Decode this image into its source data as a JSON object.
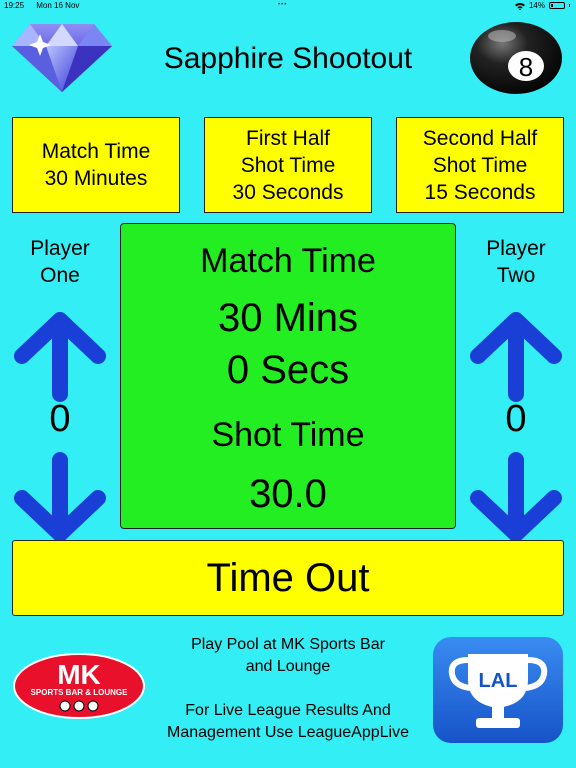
{
  "status_bar": {
    "time": "19:25",
    "date": "Mon 16 Nov",
    "battery": "14%"
  },
  "header": {
    "title": "Sapphire Shootout"
  },
  "settings": [
    {
      "lines": [
        "Match Time",
        "30 Minutes"
      ]
    },
    {
      "lines": [
        "First Half",
        "Shot Time",
        "30 Seconds"
      ]
    },
    {
      "lines": [
        "Second Half",
        "Shot Time",
        "15 Seconds"
      ]
    }
  ],
  "player_one": {
    "label_line1": "Player",
    "label_line2": "One",
    "score": "0"
  },
  "player_two": {
    "label_line1": "Player",
    "label_line2": "Two",
    "score": "0"
  },
  "timer": {
    "match_label": "Match Time",
    "minutes": "30 Mins",
    "seconds": "0 Secs",
    "shot_label": "Shot Time",
    "shot_value": "30.0"
  },
  "timeout_button": {
    "label": "Time Out"
  },
  "footer": {
    "line1": "Play Pool at MK Sports Bar",
    "line2": "and Lounge",
    "line3": "For Live League Results And",
    "line4": "Management Use LeagueAppLive",
    "mk_logo_text": "MK",
    "mk_logo_sub": "SPORTS BAR & LOUNGE",
    "lal_logo_text": "LAL"
  },
  "colors": {
    "background": "#33eef4",
    "setting_box": "#ffff00",
    "timer_panel": "#22ee22",
    "arrow": "#1a3fd6",
    "mk_red": "#e8102a",
    "lal_blue": "#1f6fe0"
  },
  "icons": {
    "diamond": "diamond-icon",
    "eight_ball": "eight-ball-icon",
    "up_arrow": "arrow-up-icon",
    "down_arrow": "arrow-down-icon"
  }
}
